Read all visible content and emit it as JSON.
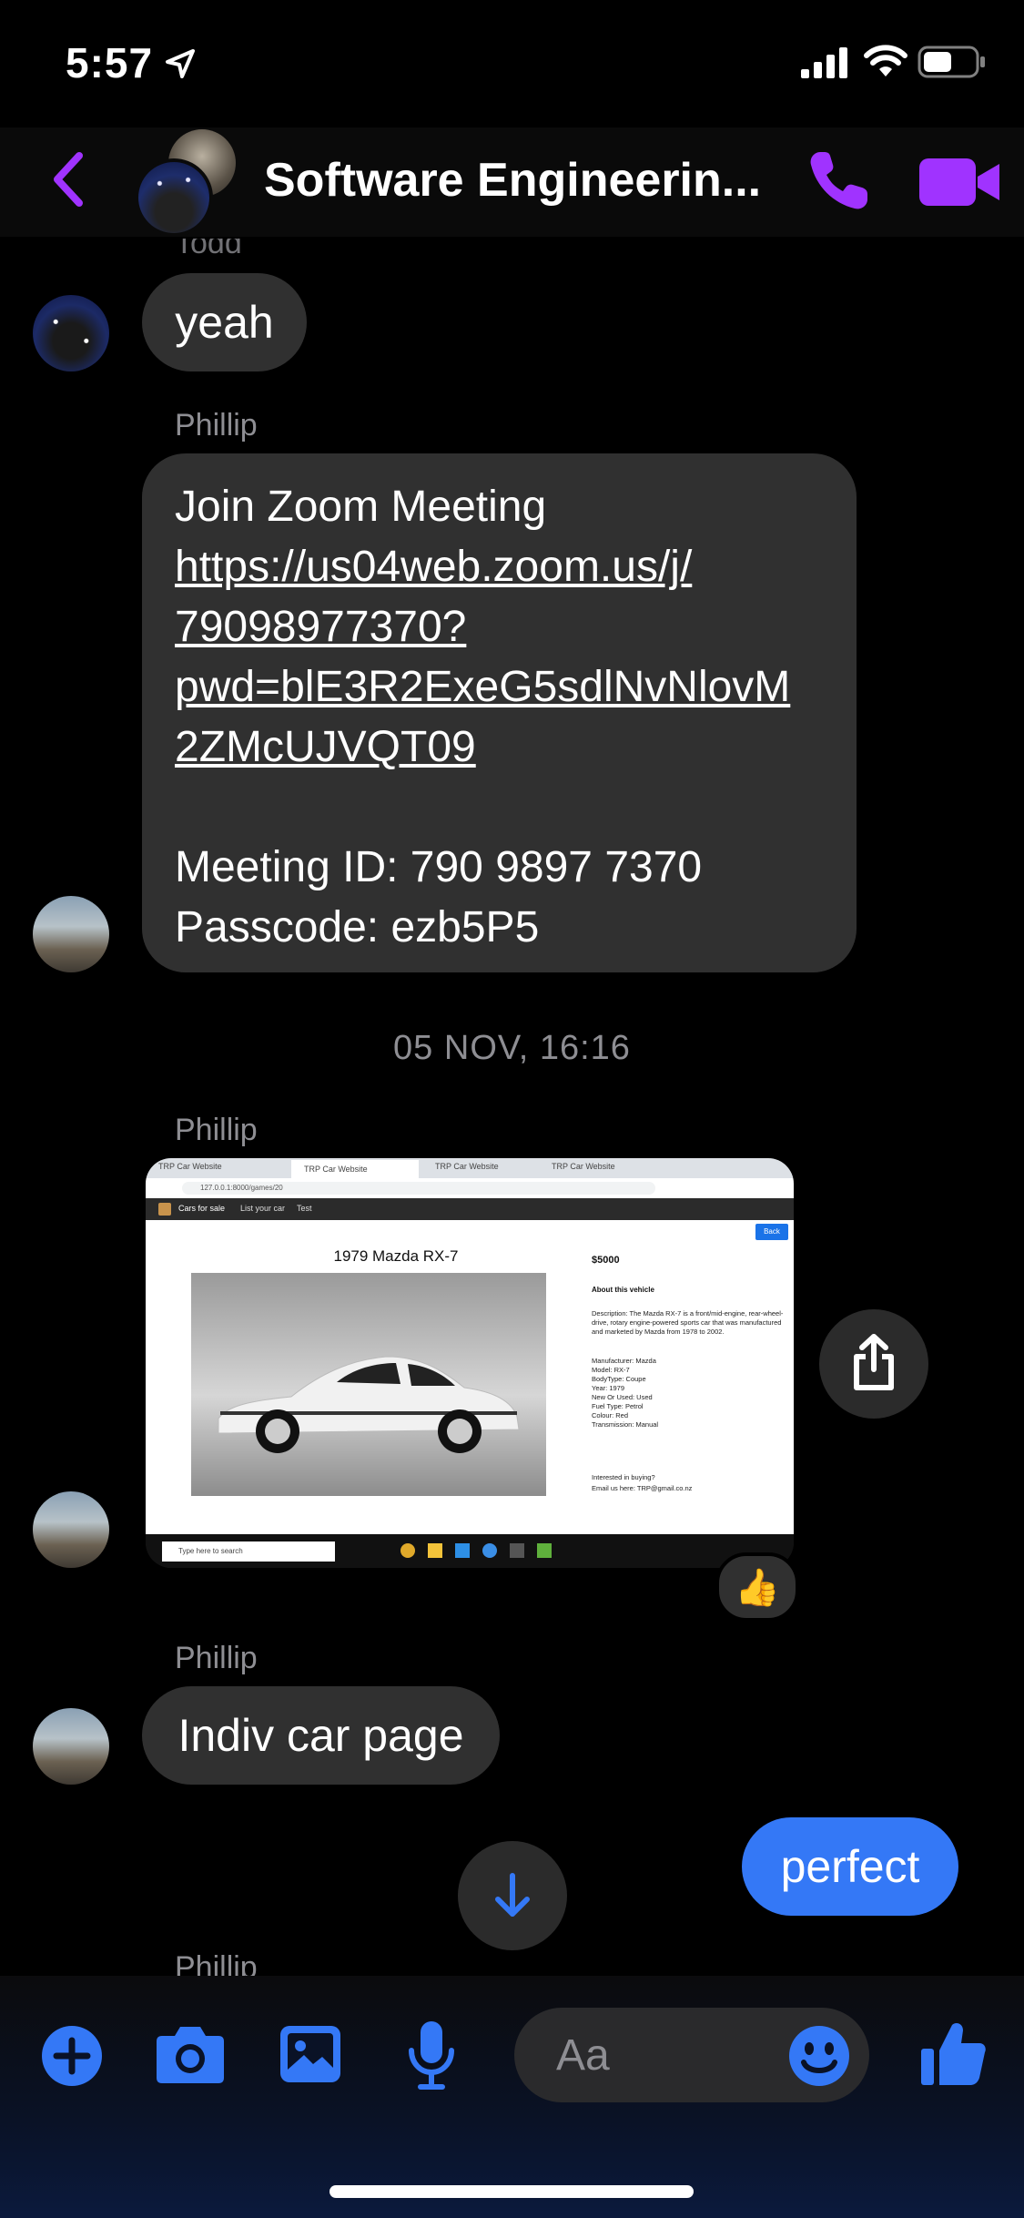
{
  "status": {
    "time": "5:57"
  },
  "header": {
    "title": "Software Engineerin..."
  },
  "messages": {
    "todd_name": "Todd",
    "todd_msg": "yeah",
    "phillip1_name": "Phillip",
    "zoom_line1": "Join Zoom Meeting",
    "zoom_link_l1": "https://us04web.zoom.us/j/",
    "zoom_link_l2": "79098977370?",
    "zoom_link_l3": "pwd=blE3R2ExeG5sdlNvNlovM",
    "zoom_link_l4": "2ZMcUJVQT09",
    "meeting_id": "Meeting ID: 790 9897 7370",
    "passcode": "Passcode: ezb5P5",
    "timestamp": "05 NOV, 16:16",
    "phillip2_name": "Phillip",
    "reaction": "👍",
    "phillip3_name": "Phillip",
    "indiv_msg": "Indiv car page",
    "my_msg": "perfect",
    "phillip4_name": "Phillip"
  },
  "screenshot": {
    "tabs": [
      "TRP Car Website",
      "TRP Car Website",
      "TRP Car Website",
      "TRP Car Website"
    ],
    "url": "127.0.0.1:8000/games/20",
    "nav": [
      "Cars for sale",
      "List your car",
      "Test"
    ],
    "back": "Back",
    "car_title": "1979 Mazda RX-7",
    "price": "$5000",
    "about": "About this vehicle",
    "description": "Description: The Mazda RX-7 is a front/mid-engine, rear-wheel-drive, rotary engine-powered sports car that was manufactured and marketed by Mazda from 1978 to 2002.",
    "specs": [
      "Manufacturer: Mazda",
      "Model: RX-7",
      "BodyType: Coupe",
      "Year: 1979",
      "New Or Used: Used",
      "Fuel Type: Petrol",
      "Colour: Red",
      "Transmission: Manual"
    ],
    "interested": "Interested in buying?",
    "email": "Email us here: TRP@gmail.co.nz",
    "taskbar_search": "Type here to search"
  },
  "composer": {
    "placeholder": "Aa"
  },
  "colors": {
    "accent_purple": "#a033ff",
    "accent_blue": "#3478f6",
    "bubble_gray": "#303030"
  }
}
